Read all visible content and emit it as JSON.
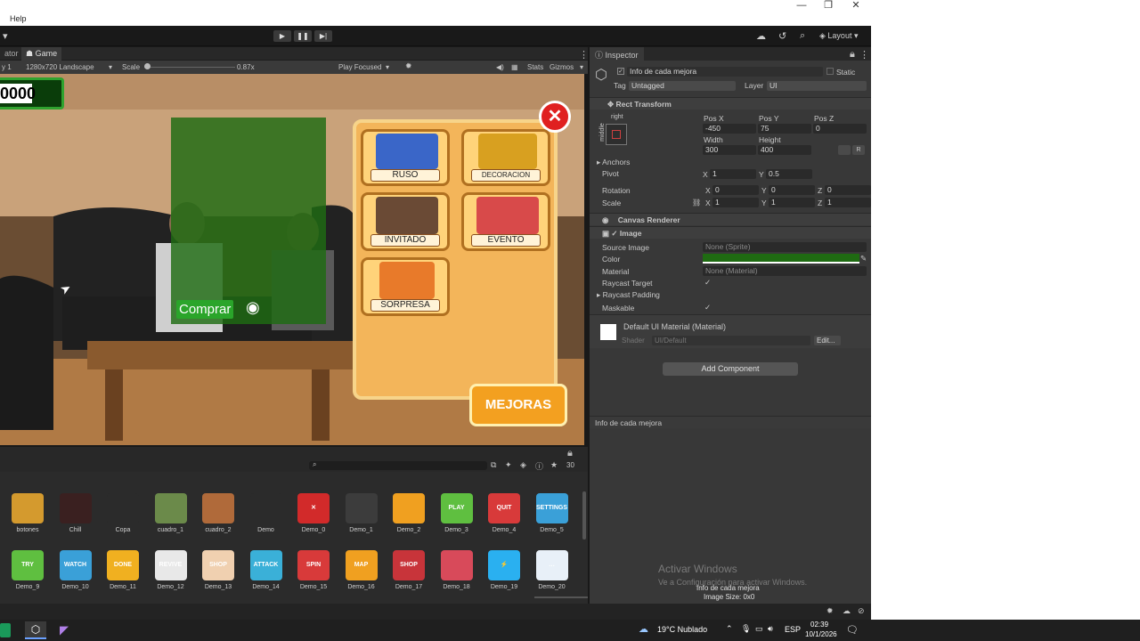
{
  "menu": {
    "help": "Help",
    "arrow": "▾"
  },
  "window": {
    "minimize": "—",
    "restore": "❐",
    "close": "✕"
  },
  "toolbar": {
    "play": "▶",
    "pause": "❚❚",
    "step": "▶|",
    "layout_label": "Layout"
  },
  "game_panel": {
    "tab_left": "ator",
    "tab_game": "Game",
    "display": "y 1",
    "resolution": "1280x720 Landscape",
    "scale_label": "Scale",
    "scale_value": "0.87x",
    "play_mode": "Play Focused",
    "stats": "Stats",
    "gizmos": "Gizmos"
  },
  "game": {
    "money": "0000",
    "buy_label": "Comprar",
    "items": [
      {
        "label": "RUSO"
      },
      {
        "label": "DECORACION"
      },
      {
        "label": "INVITADO"
      },
      {
        "label": "EVENTO"
      },
      {
        "label": "SORPRESA"
      }
    ],
    "mejoras": "MEJORAS",
    "close": "✕"
  },
  "project": {
    "count": "30",
    "row1": [
      {
        "label": "botones",
        "color": "#d49a2e"
      },
      {
        "label": "Chill",
        "color": "#3a2020"
      },
      {
        "label": "Copa",
        "color": "#2b2b2b"
      },
      {
        "label": "cuadro_1",
        "color": "#6b8a4a"
      },
      {
        "label": "cuadro_2",
        "color": "#b06a3a"
      },
      {
        "label": "Demo",
        "color": "#2b2b2b"
      },
      {
        "label": "Demo_0",
        "color": "#d22a2a",
        "text": "✕"
      },
      {
        "label": "Demo_1",
        "color": "#3c3c3c"
      },
      {
        "label": "Demo_2",
        "color": "#f0a020"
      },
      {
        "label": "Demo_3",
        "color": "#5fbf40",
        "text": "PLAY"
      },
      {
        "label": "Demo_4",
        "color": "#d83a3a",
        "text": "QUIT"
      },
      {
        "label": "Demo_5",
        "color": "#3aa0d8",
        "text": "SETTINGS"
      }
    ],
    "row2": [
      {
        "label": "Demo_9",
        "color": "#5fbf40",
        "text": "TRY"
      },
      {
        "label": "Demo_10",
        "color": "#3aa0d8",
        "text": "WATCH"
      },
      {
        "label": "Demo_11",
        "color": "#f0b020",
        "text": "DONE"
      },
      {
        "label": "Demo_12",
        "color": "#e8e8e8",
        "text": "REVIVE"
      },
      {
        "label": "Demo_13",
        "color": "#f0d0b0",
        "text": "SHOP"
      },
      {
        "label": "Demo_14",
        "color": "#3ab0d8",
        "text": "ATTACK"
      },
      {
        "label": "Demo_15",
        "color": "#d83a3a",
        "text": "SPIN"
      },
      {
        "label": "Demo_16",
        "color": "#f0a020",
        "text": "MAP"
      },
      {
        "label": "Demo_17",
        "color": "#c8343a",
        "text": "SHOP"
      },
      {
        "label": "Demo_18",
        "color": "#d84a5a"
      },
      {
        "label": "Demo_19",
        "color": "#2ab0f0",
        "text": "⚡"
      },
      {
        "label": "Demo_20",
        "color": "#e8f0f8",
        "text": "…"
      }
    ]
  },
  "inspector": {
    "tab": "Inspector",
    "object_name": "Info de cada mejora",
    "static": "Static",
    "tag_label": "Tag",
    "tag_value": "Untagged",
    "layer_label": "Layer",
    "layer_value": "UI",
    "rect_transform": "Rect Transform",
    "anchor_h": "right",
    "anchor_v": "middle",
    "pos_x_label": "Pos X",
    "pos_y_label": "Pos Y",
    "pos_z_label": "Pos Z",
    "pos_x": "-450",
    "pos_y": "75",
    "pos_z": "0",
    "width_label": "Width",
    "height_label": "Height",
    "width": "300",
    "height": "400",
    "r_btn": "R",
    "anchors": "Anchors",
    "pivot": "Pivot",
    "pivot_x": "1",
    "pivot_y": "0.5",
    "rotation": "Rotation",
    "rot_x": "0",
    "rot_y": "0",
    "rot_z": "0",
    "scale": "Scale",
    "scale_x": "1",
    "scale_y": "1",
    "scale_z": "1",
    "x": "X",
    "y": "Y",
    "z": "Z",
    "canvas_renderer": "Canvas Renderer",
    "image": "Image",
    "source_image": "Source Image",
    "source_image_value": "None (Sprite)",
    "color": "Color",
    "color_value": "#1f6b12",
    "material": "Material",
    "material_value": "None (Material)",
    "raycast_target": "Raycast Target",
    "raycast_padding": "Raycast Padding",
    "maskable": "Maskable",
    "check": "✓",
    "default_material": "Default UI Material (Material)",
    "shader_label": "Shader",
    "shader_value": "UI/Default",
    "edit": "Edit...",
    "add_component": "Add Component",
    "preview_title": "Info de cada mejora",
    "activate_title": "Activar Windows",
    "activate_sub": "Ve a Configuración para activar Windows.",
    "preview_name": "Info de cada mejora",
    "preview_size": "Image Size: 0x0"
  },
  "taskbar": {
    "weather": "19°C  Nublado",
    "lang": "ESP",
    "time": "02:39",
    "date": "10/1/2026"
  }
}
